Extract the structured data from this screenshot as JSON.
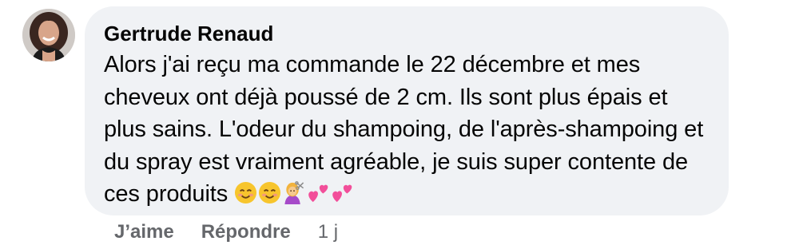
{
  "comment": {
    "author": "Gertrude Renaud",
    "text": "Alors j'ai reçu ma commande le 22 décembre et mes cheveux ont déjà poussé de 2 cm. Ils sont plus épais et plus sains. L'odeur du shampoing, de l'après-shampoing et du spray est vraiment agréable, je suis super contente de ces produits",
    "emojis": [
      "smiling-face-with-smiling-eyes",
      "smiling-face-with-smiling-eyes",
      "person-getting-haircut",
      "two-hearts",
      "two-hearts"
    ]
  },
  "actions": {
    "like_label": "J’aime",
    "reply_label": "Répondre",
    "timestamp": "1 j"
  },
  "colors": {
    "bubble_bg": "#f0f2f5",
    "text": "#050505",
    "secondary_text": "#65676b"
  }
}
